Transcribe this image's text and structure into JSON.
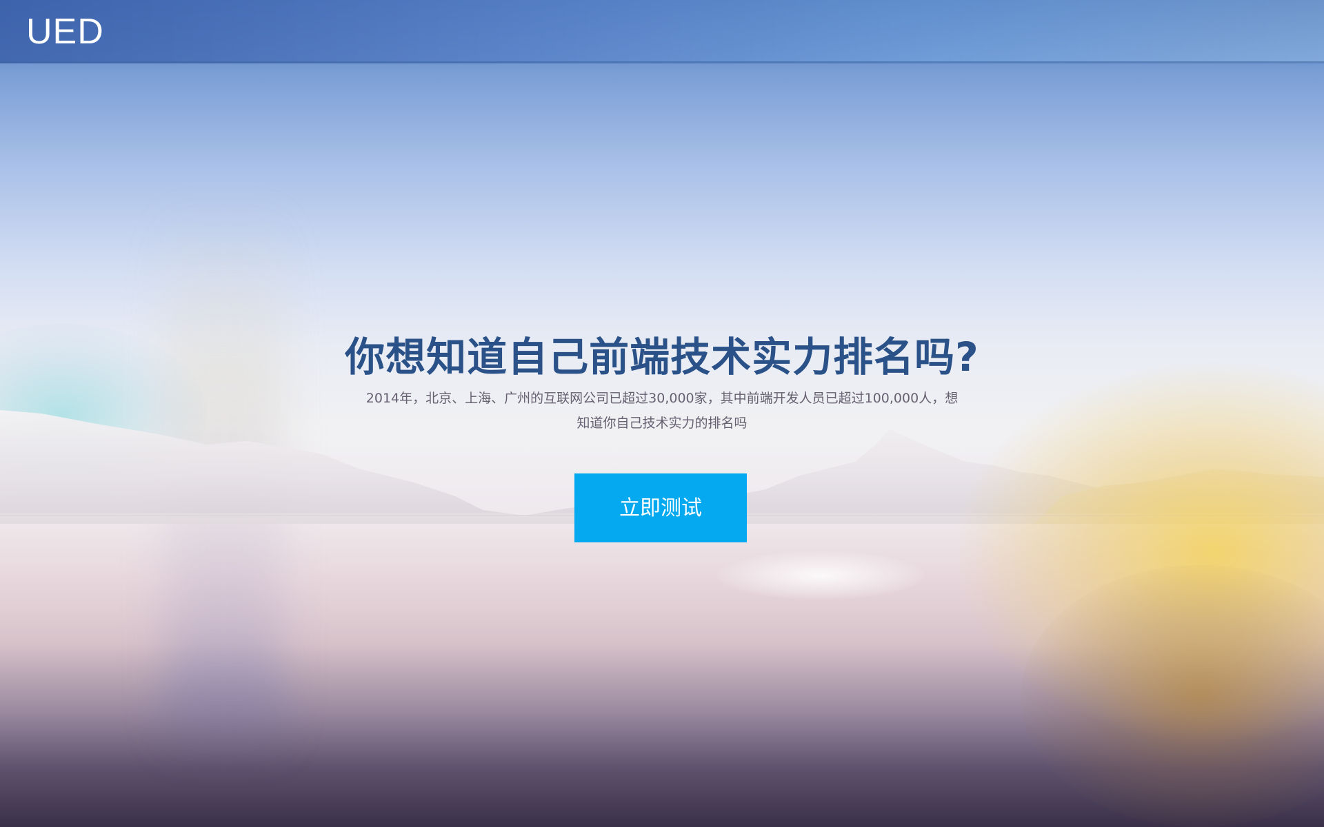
{
  "header": {
    "logo_text": "UED"
  },
  "hero": {
    "title": "你想知道自己前端技术实力排名吗?",
    "description": "2014年，北京、上海、广州的互联网公司已超过30,000家，其中前端开发人员已超过100,000人，想知道你自己技术实力的排名吗",
    "cta_label": "立即测试"
  },
  "colors": {
    "title": "#2b5288",
    "cta_background": "#04a9f0",
    "cta_text": "#ffffff",
    "description": "#666070"
  }
}
